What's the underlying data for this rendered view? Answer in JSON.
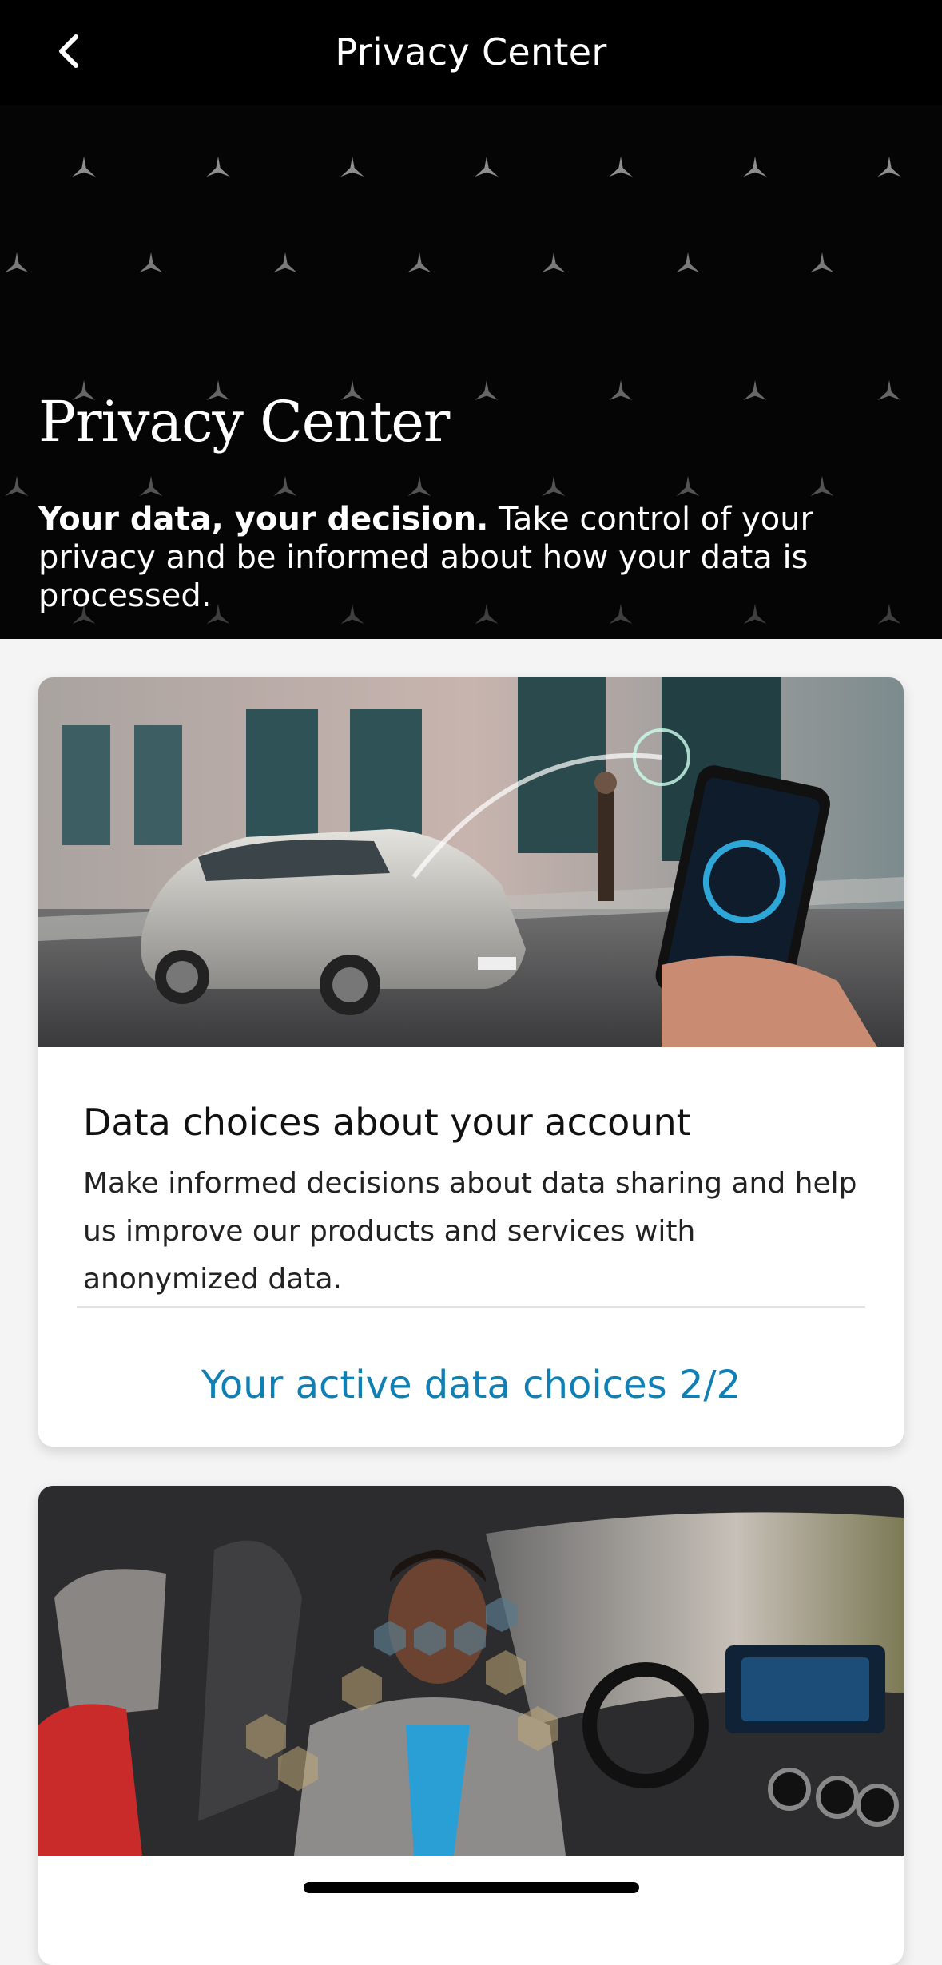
{
  "nav": {
    "title": "Privacy Center",
    "back_icon": "chevron-left-icon"
  },
  "hero": {
    "title": "Privacy Center",
    "subtitle_bold": "Your data, your decision.",
    "subtitle_rest": " Take control of your privacy and be informed about how your data is processed."
  },
  "cards": [
    {
      "image": "car-and-phone-photo",
      "title": "Data choices about your account",
      "text": "Make informed decisions about data sharing and help us improve our products and services with anonymized data.",
      "link": "Your active data choices 2/2"
    },
    {
      "image": "driver-in-car-photo"
    }
  ],
  "colors": {
    "link": "#0f7fb4",
    "nav_background": "#000000",
    "page_background": "#f4f4f4"
  }
}
